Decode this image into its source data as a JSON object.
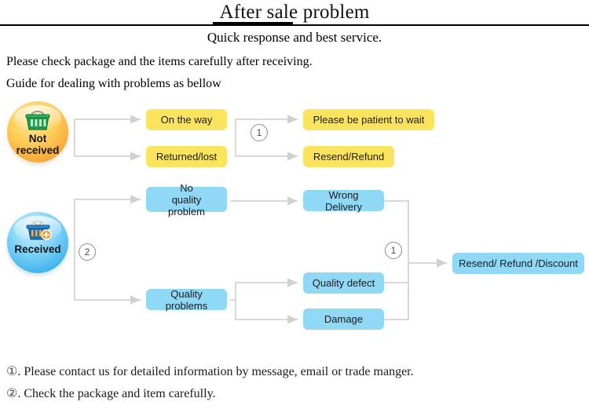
{
  "header": {
    "title": "After sale problem",
    "subtitle": "Quick response and best service.",
    "body_lines": [
      "Please check package and the items carefully after receiving.",
      "Guide for dealing with problems as bellow"
    ]
  },
  "diagram": {
    "circles": [
      {
        "id": "not-received",
        "label": "Not\nreceived",
        "label_line1": "Not",
        "label_line2": "received",
        "icon": "shopping-basket-icon",
        "color": "#f9a63a"
      },
      {
        "id": "received",
        "label": "Received",
        "icon": "shopping-basket-plus-icon",
        "color": "#46b6ee"
      }
    ],
    "boxes": [
      {
        "id": "on-the-way",
        "label": "On the way",
        "color": "#fbe45d"
      },
      {
        "id": "returned-lost",
        "label": "Returned/lost",
        "color": "#fbe45d"
      },
      {
        "id": "be-patient",
        "label": "Please be patient to wait",
        "color": "#fbe45d"
      },
      {
        "id": "resend-refund",
        "label": "Resend/Refund",
        "color": "#fbe45d"
      },
      {
        "id": "no-quality-problem",
        "label_line1": "No",
        "label_line2": "quality problem",
        "label": "No quality problem",
        "color": "#8fd8f6"
      },
      {
        "id": "quality-problems",
        "label": "Quality problems",
        "color": "#8fd8f6"
      },
      {
        "id": "wrong-delivery",
        "label": "Wrong Delivery",
        "color": "#8fd8f6"
      },
      {
        "id": "quality-defect",
        "label": "Quality defect",
        "color": "#8fd8f6"
      },
      {
        "id": "damage",
        "label": "Damage",
        "color": "#8fd8f6"
      },
      {
        "id": "final-outcome",
        "label": "Resend/ Refund /Discount",
        "color": "#8fd8f6"
      }
    ],
    "markers": [
      {
        "id": "marker-top",
        "label": "1"
      },
      {
        "id": "marker-left",
        "label": "2"
      },
      {
        "id": "marker-right",
        "label": "1"
      }
    ],
    "connector_color": "#d4d4d4"
  },
  "footer": {
    "notes": [
      {
        "marker": "①",
        "text": ". Please contact us for detailed information by message, email or trade manger."
      },
      {
        "marker": "②",
        "text": ". Check the package and item carefully."
      }
    ]
  }
}
